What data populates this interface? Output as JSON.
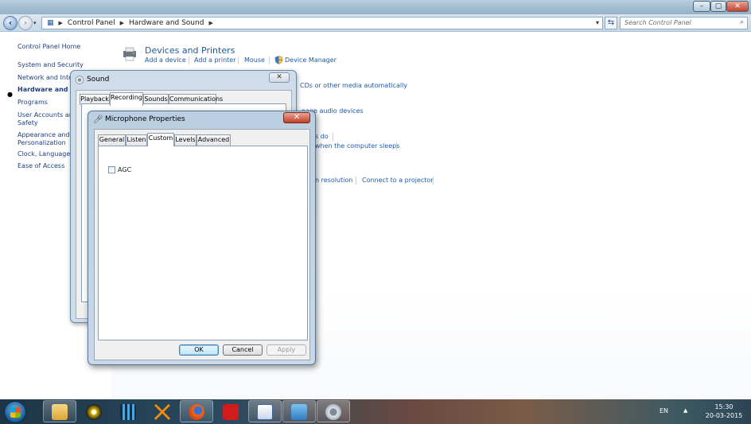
{
  "explorer": {
    "window_title": "",
    "breadcrumb": [
      "Control Panel",
      "Hardware and Sound"
    ],
    "search_placeholder": "Search Control Panel",
    "left_pane": [
      {
        "label": "Control Panel Home"
      },
      {
        "label": "System and Security"
      },
      {
        "label": "Network and Inter"
      },
      {
        "label": "Hardware and So"
      },
      {
        "label": "Programs"
      },
      {
        "label": "User Accounts and"
      },
      {
        "label": "Safety"
      },
      {
        "label": "Appearance and"
      },
      {
        "label": "Personalization"
      },
      {
        "label": "Clock, Language, a"
      },
      {
        "label": "Ease of Access"
      }
    ],
    "sections": {
      "devices_title": "Devices and Printers",
      "add_device": "Add a device",
      "add_printer": "Add a printer",
      "mouse": "Mouse",
      "device_manager": "Device Manager",
      "autoplay_fragment": "CDs or other media automatically",
      "sound_fragment": "nage audio devices",
      "power_fragment1": "s do",
      "power_fragment2": "when the computer sleeps",
      "display_fragment": "n resolution",
      "projector": "Connect to a projector"
    }
  },
  "sound_dialog": {
    "title": "Sound",
    "close_label": "✕",
    "tabs": [
      "Playback",
      "Recording",
      "Sounds",
      "Communications"
    ],
    "selected_tab": "Recording"
  },
  "mic_dialog": {
    "title": "Microphone Properties",
    "close_label": "✕",
    "tabs": [
      "General",
      "Listen",
      "Custom",
      "Levels",
      "Advanced"
    ],
    "selected_tab": "Custom",
    "agc_label": "AGC",
    "agc_checked": false,
    "ok": "OK",
    "cancel": "Cancel",
    "apply": "Apply"
  },
  "taskbar": {
    "language": "EN",
    "time": "15:30",
    "date": "20-03-2015"
  }
}
